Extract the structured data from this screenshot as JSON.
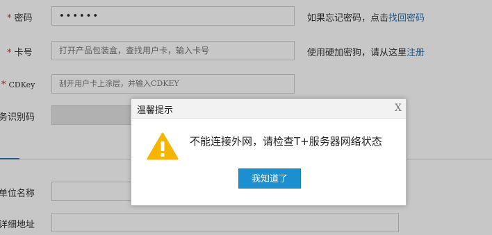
{
  "form": {
    "password": {
      "required_mark": "*",
      "label": "密码",
      "value_masked": "••••••",
      "hint_text": "如果忘记密码，点击",
      "hint_link": "找回密码"
    },
    "card_number": {
      "required_mark": "*",
      "label": "卡号",
      "placeholder": "打开产品包装盒，查找用户卡，输入卡号",
      "hint_text": "使用硬加密狗，请从这里",
      "hint_link": "注册"
    },
    "cdkey": {
      "required_mark": "*",
      "label": "CDKey",
      "placeholder": "刮开用户卡上涂层，并输入CDKEY"
    },
    "service_id": {
      "label": "务识别码"
    },
    "company_name": {
      "label": "单位名称"
    },
    "address": {
      "label": "详细地址"
    }
  },
  "dialog": {
    "title": "温馨提示",
    "close": "X",
    "icon": "warning-icon",
    "message": "不能连接外网，请检查T+服务器网络状态",
    "button": "我知道了"
  },
  "colors": {
    "required": "#d9262c",
    "link": "#2f75b5",
    "primary_button": "#1b8fd0",
    "warning_icon": "#f5b400"
  }
}
